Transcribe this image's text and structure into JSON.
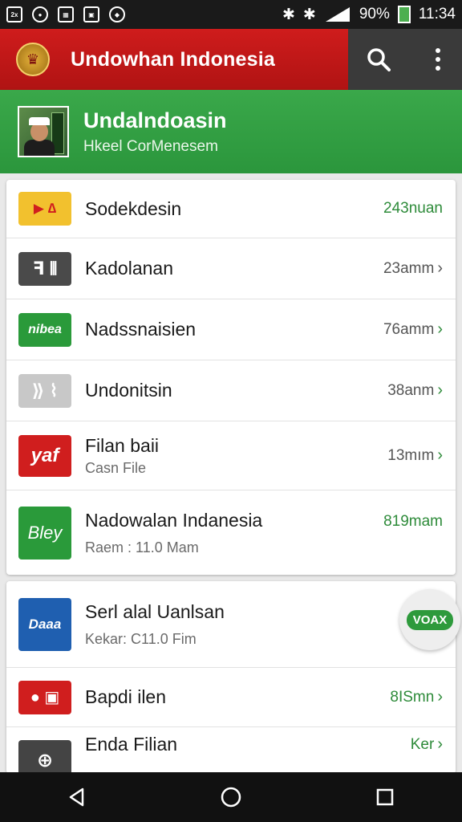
{
  "status_bar": {
    "left_icons": [
      "screenshot-icon",
      "record-icon",
      "gallery-icon",
      "bag-icon",
      "shield-icon"
    ],
    "battery": "90%",
    "time": "11:34",
    "battery_color": "#4caf50"
  },
  "app_bar": {
    "title": "Undowhan Indonesia",
    "brand_color": "#cf1c1c",
    "icons": [
      "emblem-icon",
      "search-icon",
      "more-vert-icon"
    ]
  },
  "header": {
    "title": "Undalndoasin",
    "subtitle": "Hkeel CorMenesem",
    "color": "#2b963c"
  },
  "list_primary": [
    {
      "title": "Sodekdesin",
      "subtitle": "",
      "meta": "243nuan",
      "chevron": false,
      "meta_green": true,
      "icon": "play-icon",
      "icon_color": "#f2c12e",
      "icon_text": "▶ ∆"
    },
    {
      "title": "Kadolanan",
      "subtitle": "",
      "meta": "23amm",
      "chevron": true,
      "meta_green": false,
      "icon": "gallery-app-icon",
      "icon_color": "#4a4a4a",
      "icon_text": "ꟻ ⫴"
    },
    {
      "title": "Nadssnaisien",
      "subtitle": "",
      "meta": "76amm",
      "chevron": true,
      "meta_green": false,
      "icon": "news-icon",
      "icon_color": "#2a9a3a",
      "icon_text": "nibea"
    },
    {
      "title": "Undonitsin",
      "subtitle": "",
      "meta": "38anm",
      "chevron": true,
      "meta_green": false,
      "icon": "logo-icon",
      "icon_color": "#c8c8c8",
      "icon_text": "⟫ ⌇"
    },
    {
      "title": "Filan baii",
      "subtitle": "Casn File",
      "meta": "13mım",
      "chevron": true,
      "meta_green": false,
      "icon": "yaf-icon",
      "icon_color": "#d01e1e",
      "icon_text": "yaf"
    },
    {
      "title": "Nadowalan Indanesia",
      "subtitle": "Raem : 11.0 Mam",
      "meta": "819mam",
      "chevron": false,
      "meta_green": true,
      "icon": "script-icon",
      "icon_color": "#2a9a3a",
      "icon_text": "Bley"
    }
  ],
  "list_secondary": [
    {
      "title": "Serl alal Uanlsan",
      "subtitle": "Kekar: C11.0 Fim",
      "meta": "",
      "chevron": false,
      "meta_green": false,
      "icon": "dana-icon",
      "icon_color": "#1f5fb0",
      "icon_text": "Daaa"
    },
    {
      "title": "Bapdi ilen",
      "subtitle": "",
      "meta": "8ISmn",
      "chevron": true,
      "meta_green": true,
      "icon": "tv-icon",
      "icon_color": "#d01e1e",
      "icon_text": "● ▣"
    },
    {
      "title": "Enda Filian",
      "subtitle": "",
      "meta": "Ker",
      "chevron": true,
      "meta_green": true,
      "icon": "portal-icon",
      "icon_color": "#444444",
      "icon_text": "⊕"
    }
  ],
  "fab": {
    "label": "VOAX"
  }
}
